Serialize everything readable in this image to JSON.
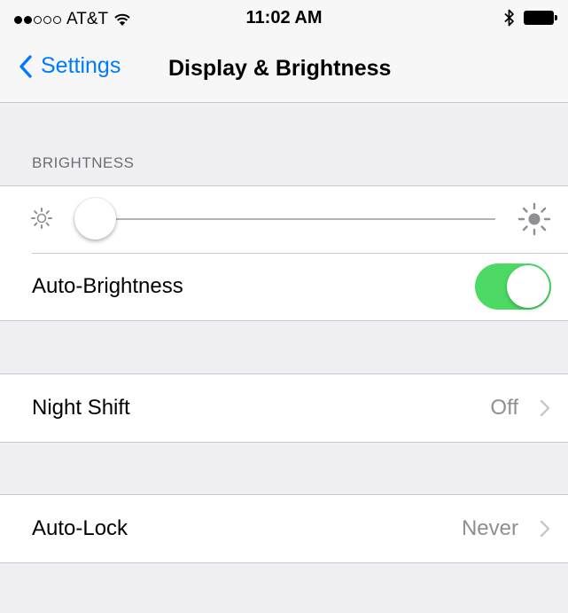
{
  "status_bar": {
    "carrier": "AT&T",
    "time": "11:02 AM",
    "signal_bars_filled": 2,
    "signal_bars_total": 5
  },
  "nav": {
    "back_label": "Settings",
    "title": "Display & Brightness"
  },
  "brightness": {
    "section_header": "BRIGHTNESS",
    "slider_level": 0.0,
    "auto_brightness_label": "Auto-Brightness",
    "auto_brightness_on": true
  },
  "night_shift": {
    "label": "Night Shift",
    "value": "Off"
  },
  "auto_lock": {
    "label": "Auto-Lock",
    "value": "Never"
  },
  "colors": {
    "accent": "#007aff",
    "toggle_on": "#4cd964",
    "background": "#efeff4"
  }
}
